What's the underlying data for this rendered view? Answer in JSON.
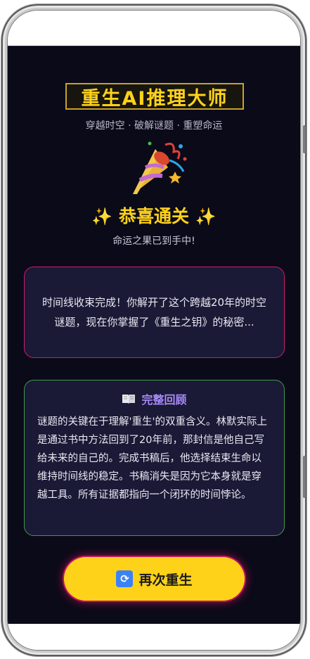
{
  "header": {
    "title": "重生AI推理大师",
    "subtitle": "穿越时空 · 破解谜题 · 重塑命运"
  },
  "result": {
    "icon": "party-popper-icon",
    "title": "恭喜通关",
    "sparkle": "✨",
    "subtitle": "命运之果已到手中!"
  },
  "summary_card": {
    "text": "时间线收束完成！你解开了这个跨越20年的时空谜题，现在你掌握了《重生之钥》的秘密..."
  },
  "review_card": {
    "icon": "open-book-icon",
    "title": "完整回顾",
    "text": "谜题的关键在于理解'重生'的双重含义。林默实际上是通过书中方法回到了20年前，那封信是他自己写给未来的自己的。完成书稿后，他选择结束生命以维持时间线的稳定。书稿消失是因为它本身就是穿越工具。所有证据都指向一个闭环的时间悖论。"
  },
  "action": {
    "icon": "cycle-arrows-icon",
    "label": "再次重生"
  },
  "colors": {
    "background": "#0b0a18",
    "gold": "#ffd21a",
    "pink_border": "#d01c6e",
    "green_border": "#3f9a4e",
    "purple_heading": "#a78bfa"
  }
}
